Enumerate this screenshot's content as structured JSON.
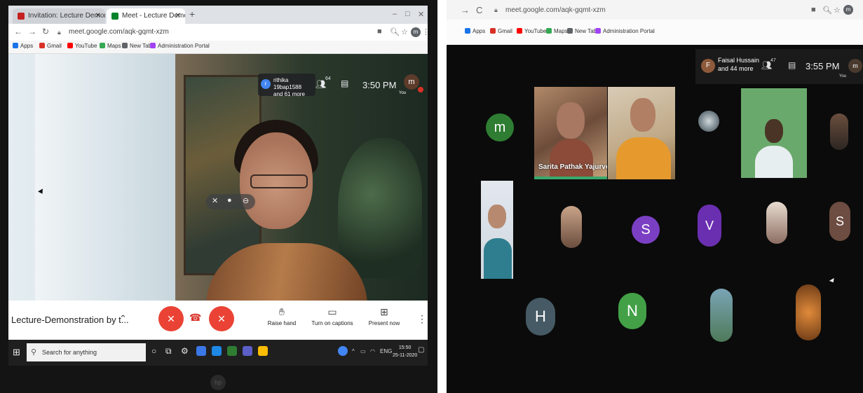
{
  "left": {
    "tabs": [
      {
        "label": "Invitation: Lecture Demonstratio",
        "favicon_color": "#c5221f"
      },
      {
        "label": "Meet - Lecture Demonstrat",
        "favicon_color": "#00832d"
      }
    ],
    "url": "meet.google.com/aqk-gqmt-xzm",
    "bookmarks": [
      {
        "label": "Apps",
        "color": "#1a73e8"
      },
      {
        "label": "Gmail",
        "color": "#d93025"
      },
      {
        "label": "YouTube",
        "color": "#ff0000"
      },
      {
        "label": "Maps",
        "color": "#34a853"
      },
      {
        "label": "New Tab",
        "color": "#5f6368"
      },
      {
        "label": "Administration Portal",
        "color": "#a142f4"
      }
    ],
    "participant_chip": {
      "initial": "r",
      "line1": "rithika 19bap1588",
      "line2": "and 61 more"
    },
    "people_count": "64",
    "time": "3:50 PM",
    "self": {
      "initial": "m",
      "label": "You"
    },
    "meeting_title": "Lecture-Demonstration by t...",
    "controls": {
      "raise_hand": "Raise hand",
      "captions": "Turn on captions",
      "present": "Present now"
    },
    "taskbar": {
      "search_placeholder": "Search for anything",
      "lang": "ENG",
      "time": "15:50",
      "date": "25-11-2020"
    },
    "accent": {
      "red": "#ea4335",
      "hangup": "#d93025"
    }
  },
  "right": {
    "url": "meet.google.com/aqk-gqmt-xzm",
    "bookmarks": [
      {
        "label": "Apps",
        "color": "#1a73e8"
      },
      {
        "label": "Gmail",
        "color": "#d93025"
      },
      {
        "label": "YouTube",
        "color": "#ff0000"
      },
      {
        "label": "Maps",
        "color": "#34a853"
      },
      {
        "label": "New Tab",
        "color": "#5f6368"
      },
      {
        "label": "Administration Portal",
        "color": "#a142f4"
      }
    ],
    "host_chip": {
      "initial": "F",
      "line1": "Faisal Hussain",
      "line2": "and 44 more"
    },
    "people_count": "47",
    "time": "3:55 PM",
    "self": {
      "initial": "m",
      "label": "You"
    },
    "speaker_tile": "Sarita Pathak Yajurve...",
    "avatars": [
      {
        "initial": "m",
        "color": "#2e7d32"
      },
      {
        "initial": "S",
        "color": "#7b3fc4"
      },
      {
        "initial": "V",
        "color": "#6a2fb0"
      },
      {
        "initial": "S",
        "color": "#6d4c41"
      },
      {
        "initial": "H",
        "color": "#455a64"
      },
      {
        "initial": "N",
        "color": "#43a047"
      }
    ]
  }
}
